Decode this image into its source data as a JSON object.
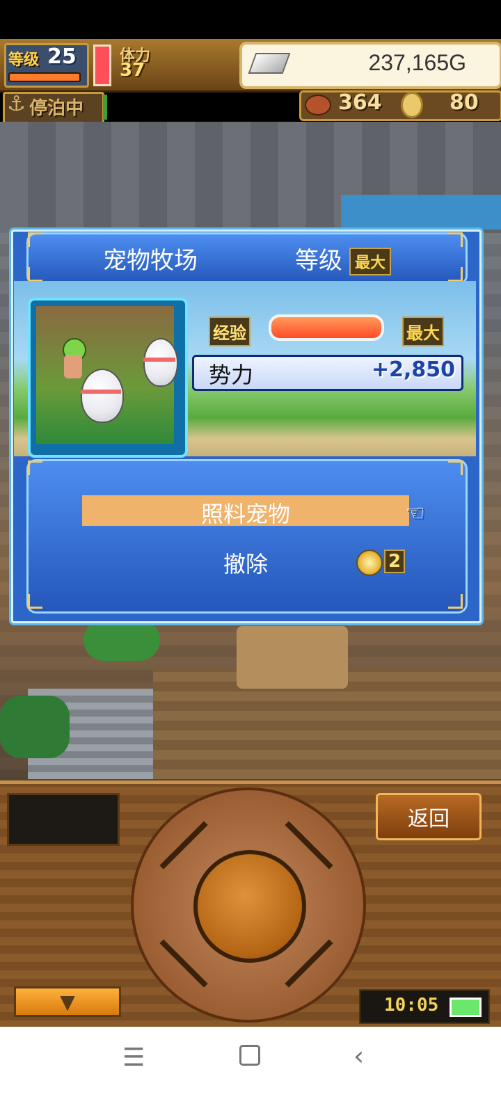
{
  "hud": {
    "level_label": "等级",
    "level_value": "25",
    "stamina_label": "体力",
    "stamina_value": "37",
    "gold_value": "237,165G",
    "anchor_label": "停泊中",
    "food_value": "364",
    "medal_value": "80"
  },
  "modal": {
    "title": "宠物牧场",
    "level_label": "等级",
    "level_badge": "最大",
    "exp_label": "经验",
    "exp_max": "最大",
    "power_label": "势力",
    "power_value": "+2,850",
    "menu_items": [
      {
        "label": "照料宠物",
        "selected": true
      },
      {
        "label": "撤除",
        "cost": "2"
      }
    ]
  },
  "controls": {
    "back_label": "返回",
    "down_label": "▼",
    "clock": "10:05"
  },
  "nav": {
    "menu_glyph": "☰",
    "back_glyph": "‹"
  },
  "colors": {
    "panel_blue": "#2c66c9",
    "selected_orange": "#f0b36c",
    "wood_brown": "#8a5a2a"
  }
}
